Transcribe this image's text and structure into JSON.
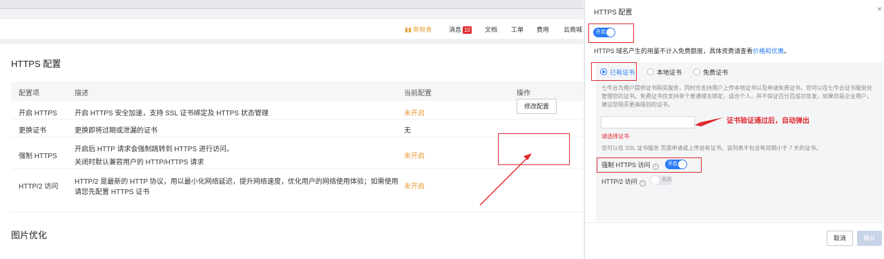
{
  "nav": {
    "gift": "新鲜食",
    "messages": "消息",
    "messages_count": "10",
    "docs": "文档",
    "tickets": "工单",
    "fees": "费用",
    "cloud": "云商城"
  },
  "https_section": {
    "title": "HTTPS 配置",
    "columns": [
      "配置项",
      "描述",
      "当前配置",
      "操作"
    ],
    "rows": [
      {
        "name": "开启 HTTPS",
        "desc": "开启 HTTPS 安全加速，支持 SSL 证书绑定及 HTTPS 状态管理",
        "value": "未开启"
      },
      {
        "name": "更换证书",
        "desc": "更换即将过期或泄漏的证书",
        "value": "无"
      },
      {
        "name": "强制 HTTPS",
        "desc": "开启后 HTTP 请求会强制跳转到 HTTPS 进行访问。",
        "desc2": "关闭时默认兼容用户的 HTTP/HTTPS 请求",
        "value": "未开启"
      },
      {
        "name": "HTTP/2 访问",
        "desc": "HTTP/2 是最新的 HTTP 协议，用以最小化网络延迟，提升网络速度，优化用户的网络使用体验；如需使用",
        "desc2": "请您先配置 HTTPS 证书",
        "value": "未开启"
      }
    ],
    "edit_button": "修改配置"
  },
  "image_section": {
    "title": "图片优化"
  },
  "dialog": {
    "title": "HTTPS 配置",
    "close": "×",
    "toggle_on_label": "开启",
    "notice": "HTTPS 域名产生的用量不计入免费额度，具体资费请查看",
    "notice_link": "价格和优惠",
    "notice_end": "。",
    "radios": [
      "已有证书",
      "本地证书",
      "免费证书"
    ],
    "desc_text": "七牛云为用户提供证书购买服务，同时也支持用户上传本地证书以及申请免费证书，您可以在七牛云证书服务处管理您的证书。免费证书仅支持单个普通域名绑定，适合个人，并不保证百分百成功签发，如果您是企业用户，建议您购买更高级别的证书。",
    "arrow_label": "证书验证通过后，自动弹出",
    "error": "请选择证书",
    "note": "您可以在 SSL 证书服务 页面申请或上传自有证书。该列表不包含有效期小于 7 天的证书。",
    "force_https_label": "强制 HTTPS 访问",
    "force_toggle_label": "开启",
    "http2_label": "HTTP/2 访问",
    "http2_toggle_label": "关闭",
    "cancel": "取消",
    "confirm": "确认"
  },
  "colors": {
    "accent": "#2b7cf6",
    "warning": "#e89c3a",
    "annotation": "#e0292f"
  }
}
